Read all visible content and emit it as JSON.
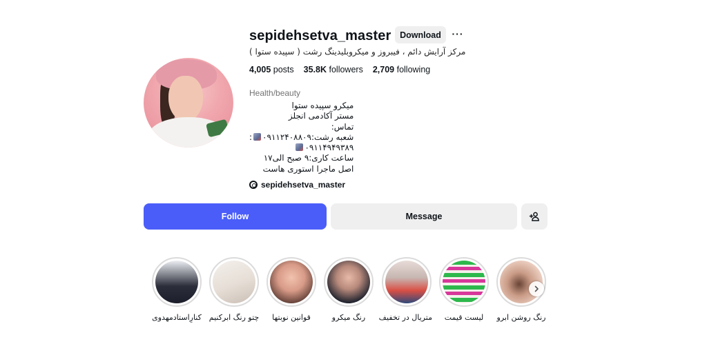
{
  "profile": {
    "username": "sepidehsetva_master",
    "download_label": "Download",
    "more_label": "···",
    "tagline": "مرکز آرایش دائم ، فیبروز و میکروبلیدینگ رشت ( سپیده ستوا )",
    "stats": {
      "posts_value": "4,005",
      "posts_label": "posts",
      "followers_value": "35.8K",
      "followers_label": "followers",
      "following_value": "2,709",
      "following_label": "following"
    },
    "category": "Health/beauty",
    "bio": {
      "line1": "میکرو سپیده ستوا",
      "line2": "مستر آکادمی انجلز",
      "line3": "تماس:",
      "line4": "شعبه رشت:۰۹۱۱۲۴۰۸۸۰۹",
      "line4_suffix": ":",
      "line5": "۰۹۱۱۴۹۴۹۳۸۹",
      "line6": "ساعت کاری:۹ صبح الی۱۷",
      "line7": "اصل ماجرا استوری هاست"
    },
    "threads_handle": "sepidehsetva_master"
  },
  "actions": {
    "follow_label": "Follow",
    "message_label": "Message"
  },
  "highlights": [
    {
      "label": "کنارِاستادمهدوی"
    },
    {
      "label": "چتو رنگ ابرکنیم"
    },
    {
      "label": "قوانین نوبتها"
    },
    {
      "label": "رنگ میکرو"
    },
    {
      "label": "متریال در تخفیف"
    },
    {
      "label": "لیست قیمت"
    },
    {
      "label": "رنگ روشن ابرو"
    }
  ],
  "colors": {
    "follow_button": "#4a5df9",
    "secondary_button": "#efefef",
    "muted_text": "#737373",
    "highlight_ring": "#dbdbdb"
  },
  "icons": {
    "more": "more-dots-icon",
    "threads": "threads-icon",
    "suggest": "add-person-icon",
    "next": "chevron-right-icon",
    "phone_pin": "pin-icon"
  }
}
